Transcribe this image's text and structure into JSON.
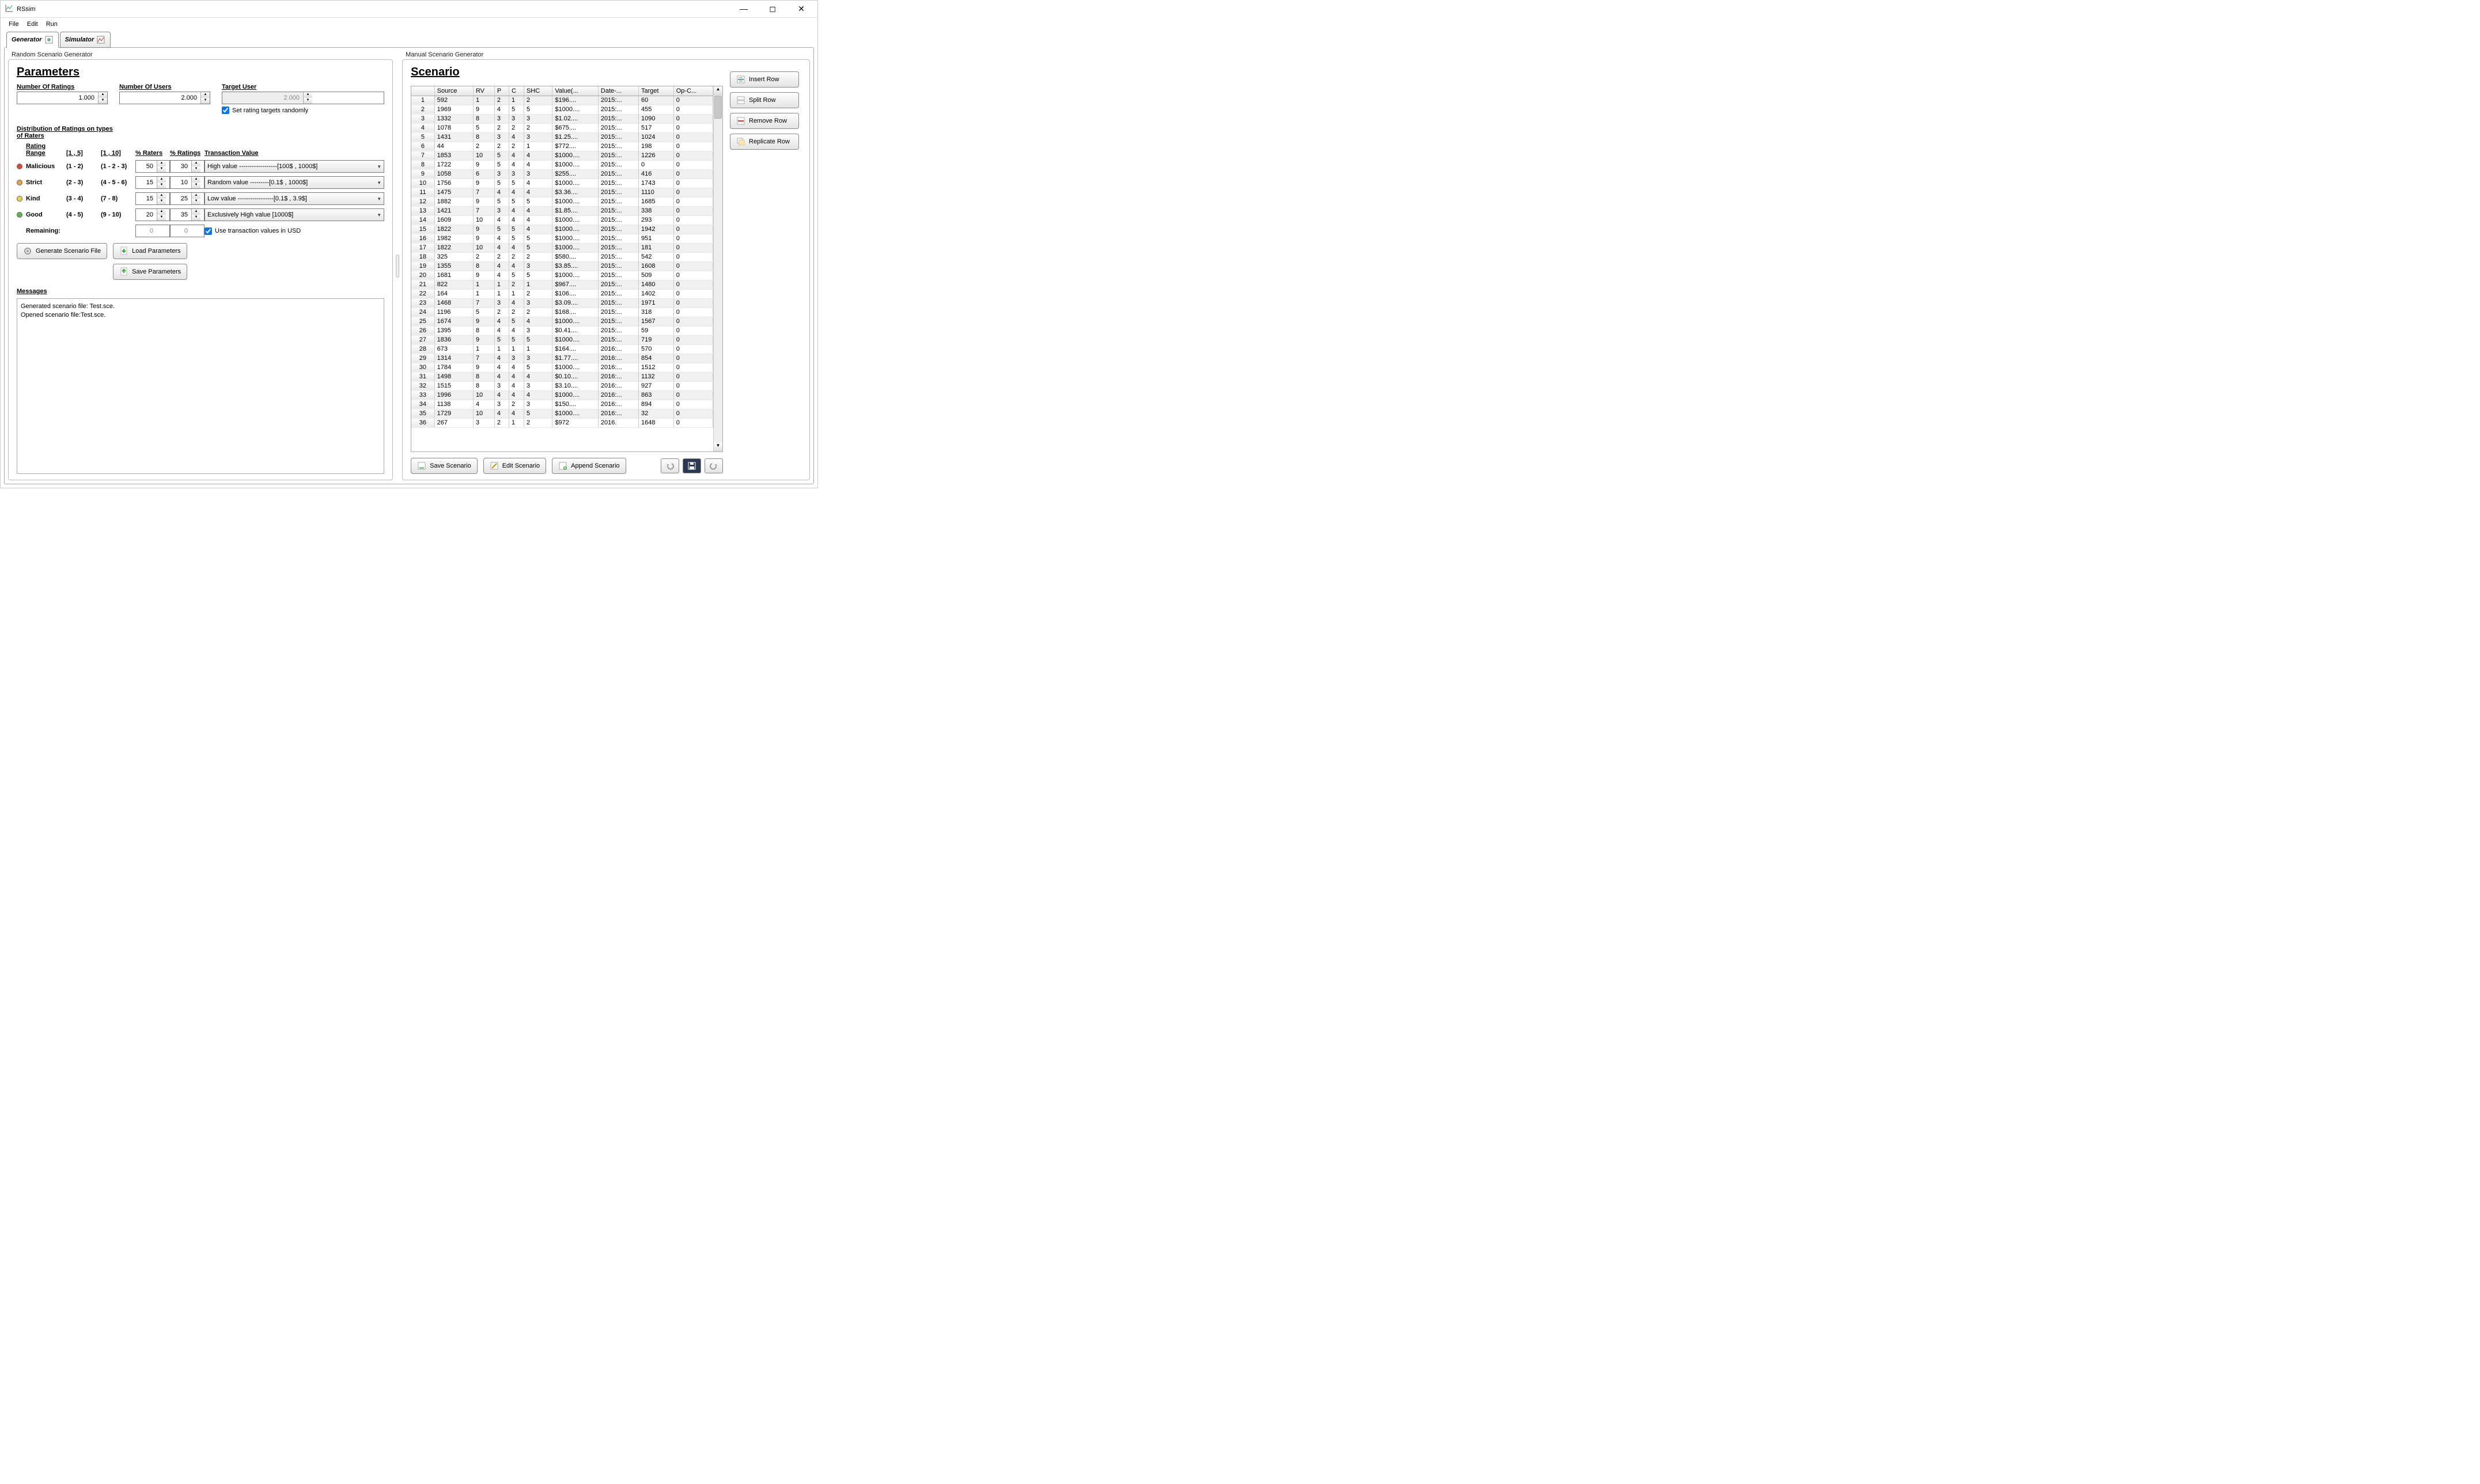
{
  "app_title": "RSsim",
  "menu": {
    "file": "File",
    "edit": "Edit",
    "run": "Run"
  },
  "tabs": {
    "generator": "Generator",
    "simulator": "Simulator"
  },
  "left": {
    "group_label": "Random Scenario Generator",
    "heading": "Parameters",
    "num_ratings_label": "Number Of Ratings",
    "num_ratings": "1.000",
    "num_users_label": "Number Of Users",
    "num_users": "2.000",
    "target_user_label": "Target User",
    "target_user": "2.000",
    "set_random_label": "Set rating targets randomly",
    "dist_label1": "Distribution of Ratings on types",
    "dist_label2": "of Raters",
    "head_range": "Rating Range",
    "head_r1": "[1 , 5]",
    "head_r2": "[1 , 10]",
    "head_praters": "% Raters",
    "head_pratings": "% Ratings",
    "head_txn": "Transaction Value",
    "rows": [
      {
        "color": "#d94a3a",
        "name": "Malicious",
        "r1": "(1 - 2)",
        "r2": "(1 - 2 - 3)",
        "pr": "50",
        "pg": "30",
        "sel": "High value ------------------[100$ , 1000$]"
      },
      {
        "color": "#e8a23a",
        "name": "Strict",
        "r1": "(2 - 3)",
        "r2": "(4 - 5 - 6)",
        "pr": "15",
        "pg": "10",
        "sel": "Random value ---------[0.1$ , 1000$]"
      },
      {
        "color": "#e8d24a",
        "name": "Kind",
        "r1": "(3 - 4)",
        "r2": "(7 - 8)",
        "pr": "15",
        "pg": "25",
        "sel": "Low value -----------------[0.1$ , 3.9$]"
      },
      {
        "color": "#5ab648",
        "name": "Good",
        "r1": "(4 - 5)",
        "r2": "(9 - 10)",
        "pr": "20",
        "pg": "35",
        "sel": "Exclusively High value [1000$]"
      }
    ],
    "remaining_label": "Remaining:",
    "rem1": "0",
    "rem2": "0",
    "use_usd": "Use transaction values in USD",
    "btn_gen": "Generate Scenario File",
    "btn_load": "Load Parameters",
    "btn_save": "Save Parameters",
    "msg_label": "Messages",
    "msg1": "Generated scenario file: Test.sce.",
    "msg2": "Opened scenario file:Test.sce."
  },
  "right": {
    "group_label": "Manual Scenario Generator",
    "heading": "Scenario",
    "cols": [
      "",
      "Source",
      "RV",
      "P",
      "C",
      "SHC",
      "Value(...",
      "Date-...",
      "Target",
      "Op-C..."
    ],
    "rows": [
      [
        "1",
        "592",
        "1",
        "2",
        "1",
        "2",
        "$196....",
        "2015:...",
        "60",
        "0"
      ],
      [
        "2",
        "1969",
        "9",
        "4",
        "5",
        "5",
        "$1000....",
        "2015:...",
        "455",
        "0"
      ],
      [
        "3",
        "1332",
        "8",
        "3",
        "3",
        "3",
        "$1.02....",
        "2015:...",
        "1090",
        "0"
      ],
      [
        "4",
        "1078",
        "5",
        "2",
        "2",
        "2",
        "$675....",
        "2015:...",
        "517",
        "0"
      ],
      [
        "5",
        "1431",
        "8",
        "3",
        "4",
        "3",
        "$1.25....",
        "2015:...",
        "1024",
        "0"
      ],
      [
        "6",
        "44",
        "2",
        "2",
        "2",
        "1",
        "$772....",
        "2015:...",
        "198",
        "0"
      ],
      [
        "7",
        "1853",
        "10",
        "5",
        "4",
        "4",
        "$1000....",
        "2015:...",
        "1226",
        "0"
      ],
      [
        "8",
        "1722",
        "9",
        "5",
        "4",
        "4",
        "$1000....",
        "2015:...",
        "0",
        "0"
      ],
      [
        "9",
        "1058",
        "6",
        "3",
        "3",
        "3",
        "$255....",
        "2015:...",
        "416",
        "0"
      ],
      [
        "10",
        "1756",
        "9",
        "5",
        "5",
        "4",
        "$1000....",
        "2015:...",
        "1743",
        "0"
      ],
      [
        "11",
        "1475",
        "7",
        "4",
        "4",
        "4",
        "$3.36....",
        "2015:...",
        "1110",
        "0"
      ],
      [
        "12",
        "1882",
        "9",
        "5",
        "5",
        "5",
        "$1000....",
        "2015:...",
        "1685",
        "0"
      ],
      [
        "13",
        "1421",
        "7",
        "3",
        "4",
        "4",
        "$1.85....",
        "2015:...",
        "338",
        "0"
      ],
      [
        "14",
        "1609",
        "10",
        "4",
        "4",
        "4",
        "$1000....",
        "2015:...",
        "293",
        "0"
      ],
      [
        "15",
        "1822",
        "9",
        "5",
        "5",
        "4",
        "$1000....",
        "2015:...",
        "1942",
        "0"
      ],
      [
        "16",
        "1982",
        "9",
        "4",
        "5",
        "5",
        "$1000....",
        "2015:...",
        "951",
        "0"
      ],
      [
        "17",
        "1822",
        "10",
        "4",
        "4",
        "5",
        "$1000....",
        "2015:...",
        "181",
        "0"
      ],
      [
        "18",
        "325",
        "2",
        "2",
        "2",
        "2",
        "$580....",
        "2015:...",
        "542",
        "0"
      ],
      [
        "19",
        "1355",
        "8",
        "4",
        "4",
        "3",
        "$3.85....",
        "2015:...",
        "1608",
        "0"
      ],
      [
        "20",
        "1681",
        "9",
        "4",
        "5",
        "5",
        "$1000....",
        "2015:...",
        "509",
        "0"
      ],
      [
        "21",
        "822",
        "1",
        "1",
        "2",
        "1",
        "$967....",
        "2015:...",
        "1480",
        "0"
      ],
      [
        "22",
        "164",
        "1",
        "1",
        "1",
        "2",
        "$106....",
        "2015:...",
        "1402",
        "0"
      ],
      [
        "23",
        "1468",
        "7",
        "3",
        "4",
        "3",
        "$3.09....",
        "2015:...",
        "1971",
        "0"
      ],
      [
        "24",
        "1196",
        "5",
        "2",
        "2",
        "2",
        "$168....",
        "2015:...",
        "318",
        "0"
      ],
      [
        "25",
        "1674",
        "9",
        "4",
        "5",
        "4",
        "$1000....",
        "2015:...",
        "1567",
        "0"
      ],
      [
        "26",
        "1395",
        "8",
        "4",
        "4",
        "3",
        "$0.41....",
        "2015:...",
        "59",
        "0"
      ],
      [
        "27",
        "1836",
        "9",
        "5",
        "5",
        "5",
        "$1000....",
        "2015:...",
        "719",
        "0"
      ],
      [
        "28",
        "673",
        "1",
        "1",
        "1",
        "1",
        "$164....",
        "2016:...",
        "570",
        "0"
      ],
      [
        "29",
        "1314",
        "7",
        "4",
        "3",
        "3",
        "$1.77....",
        "2016:...",
        "854",
        "0"
      ],
      [
        "30",
        "1784",
        "9",
        "4",
        "4",
        "5",
        "$1000....",
        "2016:...",
        "1512",
        "0"
      ],
      [
        "31",
        "1498",
        "8",
        "4",
        "4",
        "4",
        "$0.10....",
        "2016:...",
        "1132",
        "0"
      ],
      [
        "32",
        "1515",
        "8",
        "3",
        "4",
        "3",
        "$3.10....",
        "2016:...",
        "927",
        "0"
      ],
      [
        "33",
        "1996",
        "10",
        "4",
        "4",
        "4",
        "$1000....",
        "2016:...",
        "863",
        "0"
      ],
      [
        "34",
        "1138",
        "4",
        "3",
        "2",
        "3",
        "$150....",
        "2016:...",
        "894",
        "0"
      ],
      [
        "35",
        "1729",
        "10",
        "4",
        "4",
        "5",
        "$1000....",
        "2016:...",
        "32",
        "0"
      ],
      [
        "36",
        "267",
        "3",
        "2",
        "1",
        "2",
        "$972",
        "2016.",
        "1648",
        "0"
      ]
    ],
    "btn_insert": "Insert Row",
    "btn_split": "Split Row",
    "btn_remove": "Remove Row",
    "btn_replicate": "Replicate Row",
    "btn_savescn": "Save Scenario",
    "btn_editscn": "Edit Scenario",
    "btn_appendscn": "Append Scenario"
  }
}
